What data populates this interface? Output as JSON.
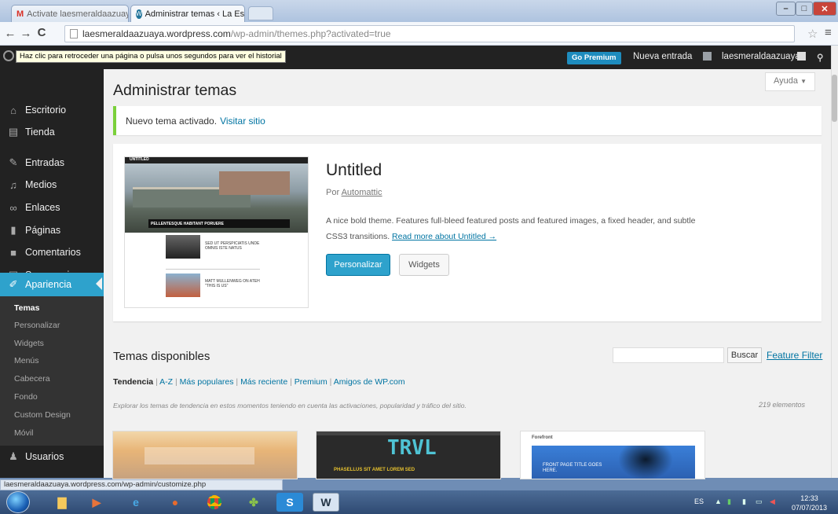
{
  "browser": {
    "tabs": [
      {
        "label": "Activate laesmeraldaazuaya",
        "icon": "gmail-icon",
        "active": false
      },
      {
        "label": "Administrar temas ‹ La Esi",
        "icon": "wordpress-icon",
        "active": true
      }
    ],
    "url_host": "laesmeraldaazuaya.wordpress.com",
    "url_path": "/wp-admin/themes.php?activated=true",
    "back_tooltip": "Haz clic para retroceder una página o pulsa unos segundos para ver el historial",
    "status_url": "laesmeraldaazuaya.wordpress.com/wp-admin/customize.php"
  },
  "adminbar": {
    "go_premium": "Go Premium",
    "new_entry": "Nueva entrada",
    "username": "laesmeraldaazuaya"
  },
  "sidebar": {
    "items": [
      {
        "label": "Escritorio",
        "icon": "home-icon"
      },
      {
        "label": "Tienda",
        "icon": "cart-icon"
      },
      {
        "label": "Entradas",
        "icon": "pin-icon"
      },
      {
        "label": "Medios",
        "icon": "media-icon"
      },
      {
        "label": "Enlaces",
        "icon": "link-icon"
      },
      {
        "label": "Páginas",
        "icon": "page-icon"
      },
      {
        "label": "Comentarios",
        "icon": "comment-icon"
      },
      {
        "label": "Sugerencias",
        "icon": "feedback-icon"
      },
      {
        "label": "Apariencia",
        "icon": "brush-icon",
        "current": true
      },
      {
        "label": "Usuarios",
        "icon": "users-icon"
      }
    ],
    "submenu": [
      "Temas",
      "Personalizar",
      "Widgets",
      "Menús",
      "Cabecera",
      "Fondo",
      "Custom Design",
      "Móvil"
    ]
  },
  "main": {
    "help": "Ayuda",
    "title": "Administrar temas",
    "notice_text": "Nuevo tema activado.",
    "notice_link": "Visitar sitio",
    "current_theme": {
      "name": "Untitled",
      "by": "Por",
      "author": "Automattic",
      "description": "A nice bold theme. Features full-bleed featured posts and featured images, a fixed header, and subtle CSS3 transitions.",
      "read_more": "Read more about Untitled →",
      "customize_button": "Personalizar",
      "widgets_button": "Widgets",
      "preview_texts": {
        "logo": "UNTITLED",
        "hero_caption": "PELLENTESQUE HABITANT PORUERE",
        "post1_title": "SED UT PERSPICIATIS UNDE OMNIS ISTE NATUS",
        "post2_title": "MATT MULLENWEG ON ATEH \"THIS IS US\""
      }
    },
    "available_title": "Temas disponibles",
    "search_button": "Buscar",
    "feature_filter": "Feature Filter",
    "filters": [
      "Tendencia",
      "A-Z",
      "Más populares",
      "Más reciente",
      "Premium",
      "Amigos de WP.com"
    ],
    "explain": "Explorar los temas de tendencia en estos momentos teniendo en cuenta las activaciones, popularidad y tráfico del sitio.",
    "count": "219 elementos",
    "cards": [
      {
        "text": ""
      },
      {
        "text": "TRVL",
        "subtext": "PHASELLUS SIT AMET LOREM SED"
      },
      {
        "text": "FRONT PAGE TITLE GOES HERE.",
        "logo": "Forefront"
      }
    ]
  },
  "taskbar": {
    "lang": "ES",
    "time": "12:33",
    "date": "07/07/2013"
  },
  "colors": {
    "admin_blue": "#2ea2cc",
    "admin_dark": "#222222",
    "notice_green": "#7ad03a",
    "link": "#0074a2"
  }
}
